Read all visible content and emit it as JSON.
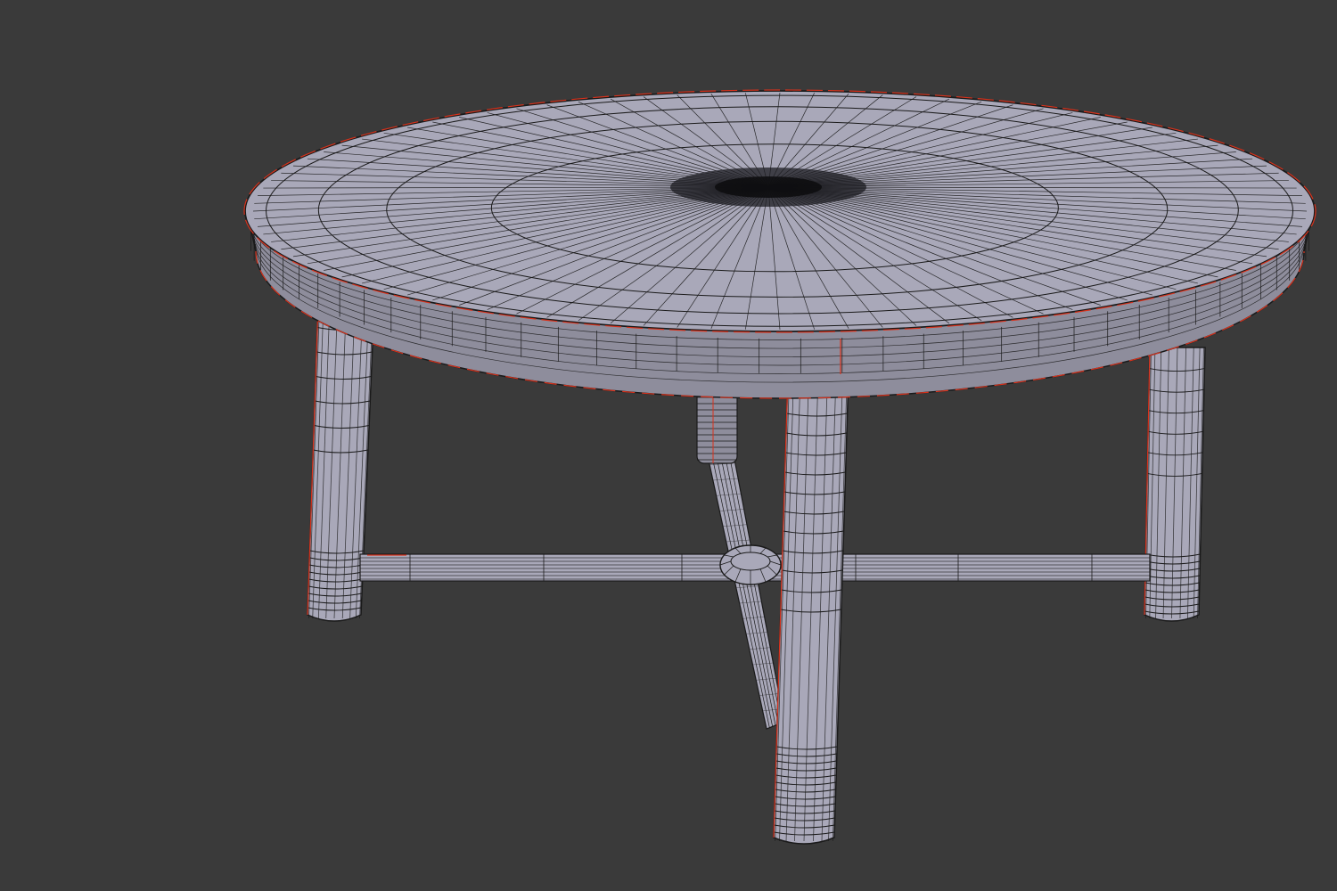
{
  "viewport": {
    "background_color": "#3a3a3a",
    "mode": "edit-mode-wireframe-overlay",
    "object": "round-table-mesh"
  },
  "mesh_style": {
    "surface_color": "#a9a8b9",
    "surface_shade_color": "#8e8d9c",
    "edge_color": "#1a1a1a",
    "seam_color": "#d8321c"
  }
}
